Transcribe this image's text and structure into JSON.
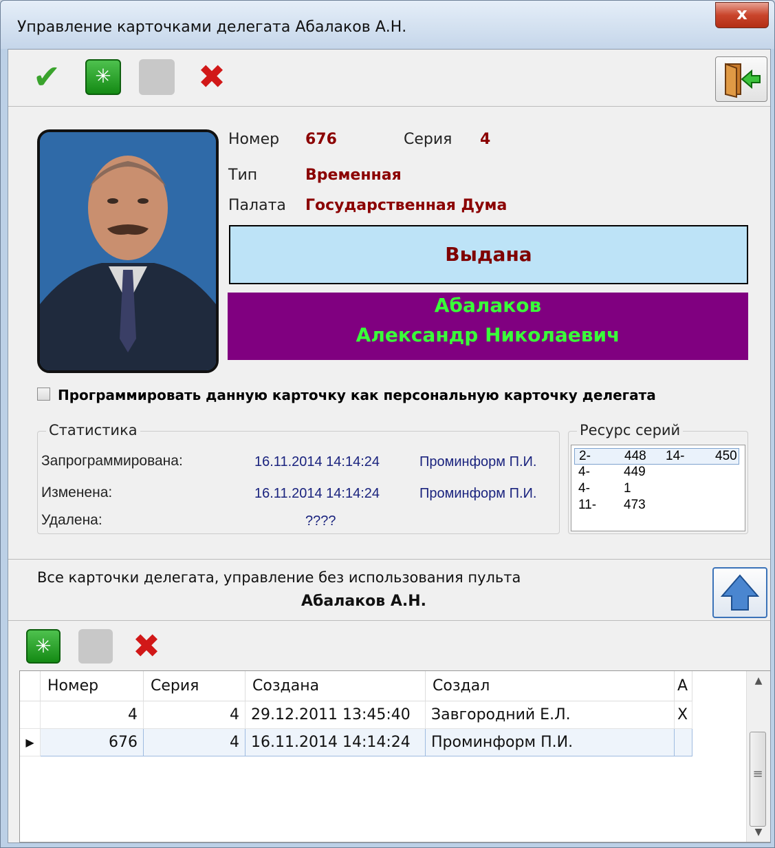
{
  "window": {
    "title": "Управление карточками делегата Абалаков А.Н.",
    "close_glyph": "x"
  },
  "toolbar": {
    "icons": [
      "checkmark-icon",
      "refresh-icon",
      "blank-button",
      "delete-icon",
      "exit-door-icon"
    ]
  },
  "card": {
    "number_label": "Номер",
    "number_value": "676",
    "series_label": "Серия",
    "series_value": "4",
    "type_label": "Тип",
    "type_value": "Временная",
    "chamber_label": "Палата",
    "chamber_value": "Государственная Дума",
    "status": "Выдана",
    "surname": "Абалаков",
    "given_names": "Александр Николаевич"
  },
  "program_checkbox": {
    "label": "Программировать данную карточку как персональную карточку делегата",
    "checked": false
  },
  "stats": {
    "title": "Статистика",
    "rows": [
      {
        "label": "Запрограммирована:",
        "date": "16.11.2014 14:14:24",
        "user": "Проминформ П.И."
      },
      {
        "label": "Изменена:",
        "date": "16.11.2014 14:14:24",
        "user": "Проминформ П.И."
      },
      {
        "label": "Удалена:",
        "date": "????",
        "user": ""
      }
    ]
  },
  "series_resource": {
    "title": "Ресурс серий",
    "items": [
      {
        "a": "2-",
        "b": "448",
        "c": "14-",
        "d": "450"
      },
      {
        "a": "4-",
        "b": "449",
        "c": "",
        "d": ""
      },
      {
        "a": "4-",
        "b": "1",
        "c": "",
        "d": ""
      },
      {
        "a": "11-",
        "b": "473",
        "c": "",
        "d": ""
      }
    ]
  },
  "all_cards": {
    "caption": "Все карточки делегата, управление без использования пульта",
    "delegate": "Абалаков А.Н."
  },
  "grid": {
    "columns": [
      "Номер",
      "Серия",
      "Создана",
      "Создал",
      "A"
    ],
    "rows": [
      {
        "number": "4",
        "series": "4",
        "created": "29.12.2011 13:45:40",
        "creator": "Завгородний Е.Л.",
        "a": "X",
        "current": false
      },
      {
        "number": "676",
        "series": "4",
        "created": "16.11.2014 14:14:24",
        "creator": "Проминформ П.И.",
        "a": "",
        "current": true
      }
    ],
    "row_marker": "▶",
    "scroll_up": "▲",
    "scroll_down": "▼",
    "scroll_grip": "≡"
  },
  "colors": {
    "status_bg": "#bde3f7",
    "name_bg": "#800080",
    "name_fg": "#39ff39",
    "value_fg": "#8b0000"
  }
}
